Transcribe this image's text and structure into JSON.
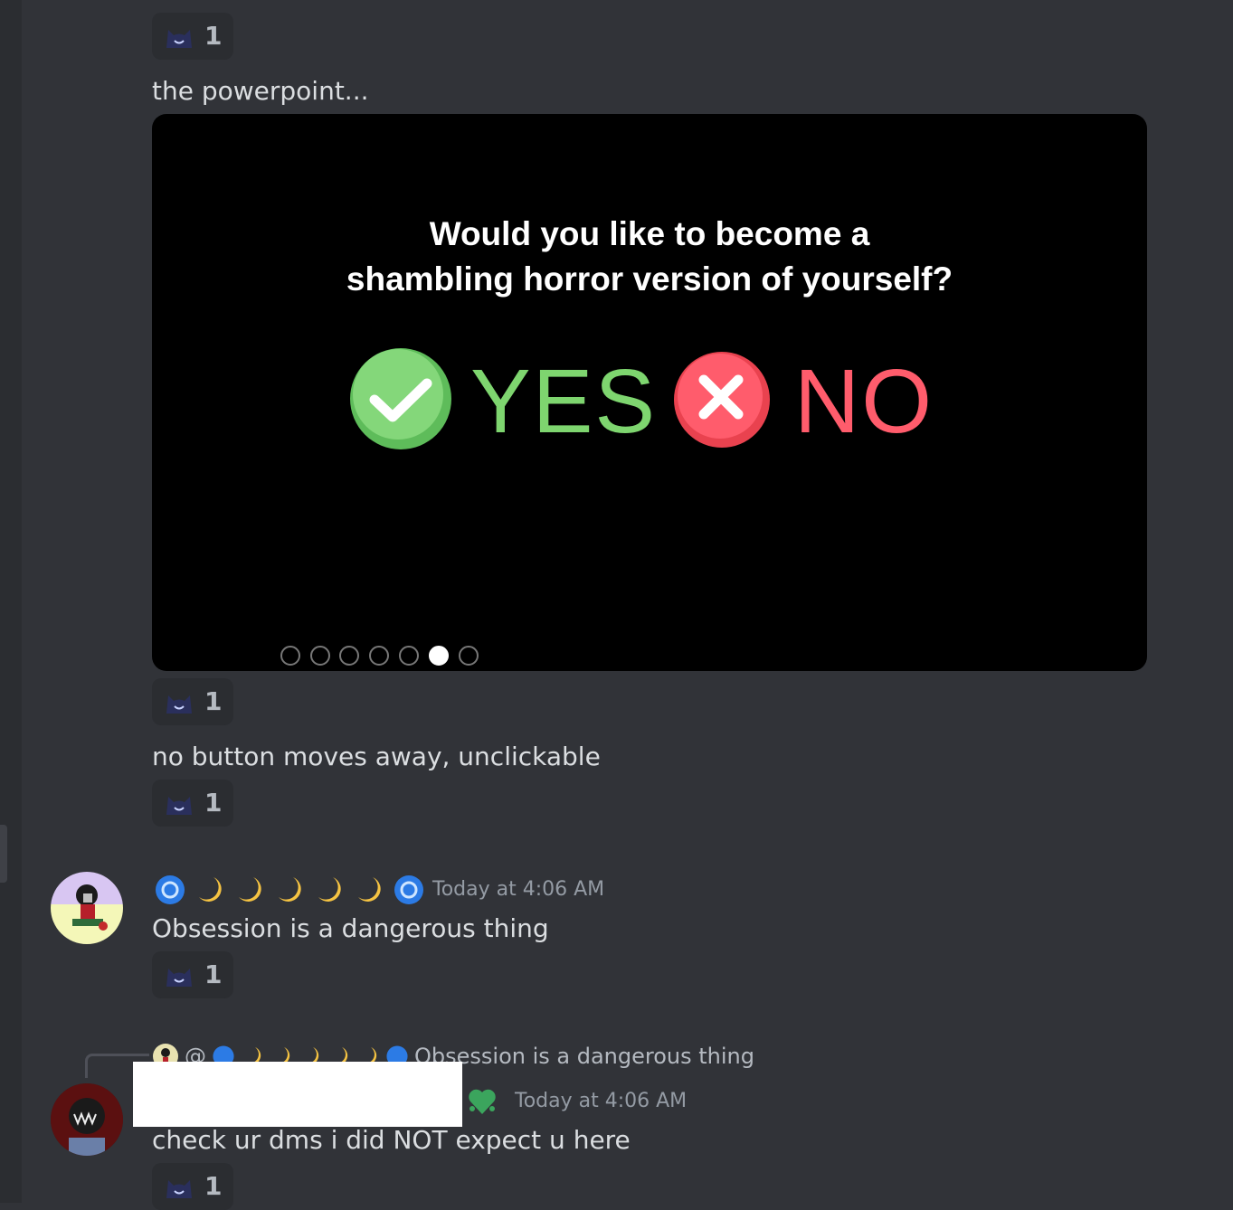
{
  "messages": {
    "m1_text": "the powerpoint...",
    "slide": {
      "question_line1": "Would you like to become a",
      "question_line2": "shambling horror version of yourself?",
      "yes_label": "YES",
      "no_label": "NO",
      "controls": [
        "prev-icon",
        "next-icon",
        "pen-icon",
        "slides-icon",
        "zoom-icon",
        "camera-icon",
        "more-icon"
      ]
    },
    "m2_text": "no button moves away, unclickable",
    "m3": {
      "timestamp": "Today at 4:06 AM",
      "text": "Obsession is a dangerous thing"
    },
    "m4": {
      "reply_at": "@",
      "reply_text": "Obsession is a dangerous thing",
      "timestamp": "Today at 4:06 AM",
      "text": "check ur dms i did NOT expect u here"
    }
  },
  "reactions": {
    "count_1": "1",
    "count_2": "1",
    "count_3": "1",
    "count_4": "1",
    "count_5": "1"
  },
  "colors": {
    "bg": "#313338",
    "yes": "#7ed56f",
    "no": "#ff5c6c",
    "muted": "#949ba4"
  }
}
